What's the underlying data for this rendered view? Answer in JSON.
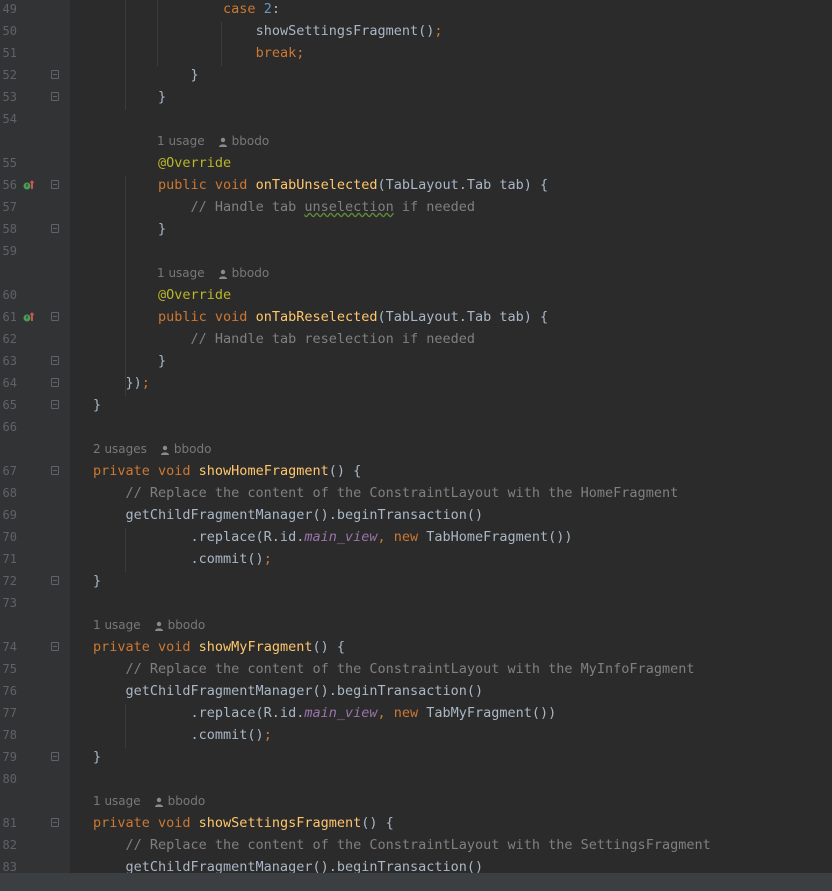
{
  "editor": {
    "lines": [
      {
        "n": "49",
        "tokens": [
          {
            "t": "                ",
            "c": ""
          },
          {
            "t": "case ",
            "c": "kw"
          },
          {
            "t": "2",
            "c": "num"
          },
          {
            "t": ":",
            "c": ""
          }
        ]
      },
      {
        "n": "50",
        "tokens": [
          {
            "t": "                    ",
            "c": ""
          },
          {
            "t": "showSettingsFragment",
            "c": ""
          },
          {
            "t": "()",
            "c": ""
          },
          {
            "t": ";",
            "c": "kw"
          }
        ]
      },
      {
        "n": "51",
        "tokens": [
          {
            "t": "                    ",
            "c": ""
          },
          {
            "t": "break;",
            "c": "kw"
          }
        ]
      },
      {
        "n": "52",
        "fold": true,
        "tokens": [
          {
            "t": "            }",
            "c": ""
          }
        ]
      },
      {
        "n": "53",
        "fold": true,
        "tokens": [
          {
            "t": "        }",
            "c": ""
          }
        ]
      },
      {
        "n": "54",
        "tokens": []
      },
      {
        "hint": true,
        "usage": "1 usage",
        "author": "bbodo",
        "indent": 8
      },
      {
        "n": "55",
        "tokens": [
          {
            "t": "        ",
            "c": ""
          },
          {
            "t": "@Override",
            "c": "ann"
          }
        ]
      },
      {
        "n": "56",
        "fold": true,
        "override": true,
        "tokens": [
          {
            "t": "        ",
            "c": ""
          },
          {
            "t": "public void ",
            "c": "kw"
          },
          {
            "t": "onTabUnselected",
            "c": "fn"
          },
          {
            "t": "(TabLayout.Tab tab) {",
            "c": ""
          }
        ]
      },
      {
        "n": "57",
        "tokens": [
          {
            "t": "            ",
            "c": ""
          },
          {
            "t": "// Handle tab ",
            "c": "cm"
          },
          {
            "t": "unselection",
            "c": "cm typo"
          },
          {
            "t": " if needed",
            "c": "cm"
          }
        ]
      },
      {
        "n": "58",
        "fold": true,
        "tokens": [
          {
            "t": "        }",
            "c": ""
          }
        ]
      },
      {
        "n": "59",
        "tokens": []
      },
      {
        "hint": true,
        "usage": "1 usage",
        "author": "bbodo",
        "indent": 8
      },
      {
        "n": "60",
        "tokens": [
          {
            "t": "        ",
            "c": ""
          },
          {
            "t": "@Override",
            "c": "ann"
          }
        ]
      },
      {
        "n": "61",
        "fold": true,
        "override": true,
        "tokens": [
          {
            "t": "        ",
            "c": ""
          },
          {
            "t": "public void ",
            "c": "kw"
          },
          {
            "t": "onTabReselected",
            "c": "fn"
          },
          {
            "t": "(TabLayout.Tab tab) {",
            "c": ""
          }
        ]
      },
      {
        "n": "62",
        "tokens": [
          {
            "t": "            ",
            "c": ""
          },
          {
            "t": "// Handle tab reselection if needed",
            "c": "cm"
          }
        ]
      },
      {
        "n": "63",
        "fold": true,
        "tokens": [
          {
            "t": "        }",
            "c": ""
          }
        ]
      },
      {
        "n": "64",
        "fold": true,
        "tokens": [
          {
            "t": "    })",
            "c": ""
          },
          {
            "t": ";",
            "c": "kw"
          }
        ]
      },
      {
        "n": "65",
        "fold": true,
        "tokens": [
          {
            "t": "}",
            "c": ""
          }
        ]
      },
      {
        "n": "66",
        "tokens": []
      },
      {
        "hint": true,
        "usage": "2 usages",
        "author": "bbodo",
        "indent": 0
      },
      {
        "n": "67",
        "fold": true,
        "tokens": [
          {
            "t": "private void ",
            "c": "kw"
          },
          {
            "t": "showHomeFragment",
            "c": "fn"
          },
          {
            "t": "() {",
            "c": ""
          }
        ]
      },
      {
        "n": "68",
        "tokens": [
          {
            "t": "    ",
            "c": ""
          },
          {
            "t": "// Replace the content of the ConstraintLayout with the HomeFragment",
            "c": "cm"
          }
        ]
      },
      {
        "n": "69",
        "tokens": [
          {
            "t": "    getChildFragmentManager().beginTransaction()",
            "c": ""
          }
        ]
      },
      {
        "n": "70",
        "tokens": [
          {
            "t": "            .replace(R.id.",
            "c": ""
          },
          {
            "t": "main_view",
            "c": "fld"
          },
          {
            "t": ", ",
            "c": "kw"
          },
          {
            "t": "new ",
            "c": "kw"
          },
          {
            "t": "TabHomeFragment())",
            "c": ""
          }
        ]
      },
      {
        "n": "71",
        "tokens": [
          {
            "t": "            .commit()",
            "c": ""
          },
          {
            "t": ";",
            "c": "kw"
          }
        ]
      },
      {
        "n": "72",
        "fold": true,
        "tokens": [
          {
            "t": "}",
            "c": ""
          }
        ]
      },
      {
        "n": "73",
        "tokens": []
      },
      {
        "hint": true,
        "usage": "1 usage",
        "author": "bbodo",
        "indent": 0
      },
      {
        "n": "74",
        "fold": true,
        "tokens": [
          {
            "t": "private void ",
            "c": "kw"
          },
          {
            "t": "showMyFragment",
            "c": "fn"
          },
          {
            "t": "() {",
            "c": ""
          }
        ]
      },
      {
        "n": "75",
        "tokens": [
          {
            "t": "    ",
            "c": ""
          },
          {
            "t": "// Replace the content of the ConstraintLayout with the MyInfoFragment",
            "c": "cm"
          }
        ]
      },
      {
        "n": "76",
        "tokens": [
          {
            "t": "    getChildFragmentManager().beginTransaction()",
            "c": ""
          }
        ]
      },
      {
        "n": "77",
        "tokens": [
          {
            "t": "            .replace(R.id.",
            "c": ""
          },
          {
            "t": "main_view",
            "c": "fld"
          },
          {
            "t": ", ",
            "c": "kw"
          },
          {
            "t": "new ",
            "c": "kw"
          },
          {
            "t": "TabMyFragment())",
            "c": ""
          }
        ]
      },
      {
        "n": "78",
        "tokens": [
          {
            "t": "            .commit()",
            "c": ""
          },
          {
            "t": ";",
            "c": "kw"
          }
        ]
      },
      {
        "n": "79",
        "fold": true,
        "tokens": [
          {
            "t": "}",
            "c": ""
          }
        ]
      },
      {
        "n": "80",
        "tokens": []
      },
      {
        "hint": true,
        "usage": "1 usage",
        "author": "bbodo",
        "indent": 0
      },
      {
        "n": "81",
        "fold": true,
        "tokens": [
          {
            "t": "private void ",
            "c": "kw"
          },
          {
            "t": "showSettingsFragment",
            "c": "fn"
          },
          {
            "t": "() {",
            "c": ""
          }
        ]
      },
      {
        "n": "82",
        "tokens": [
          {
            "t": "    ",
            "c": ""
          },
          {
            "t": "// Replace the content of the ConstraintLayout with the SettingsFragment",
            "c": "cm"
          }
        ]
      },
      {
        "n": "83",
        "tokens": [
          {
            "t": "    getChildFragmentManager().beginTransaction()",
            "c": ""
          }
        ]
      }
    ]
  }
}
